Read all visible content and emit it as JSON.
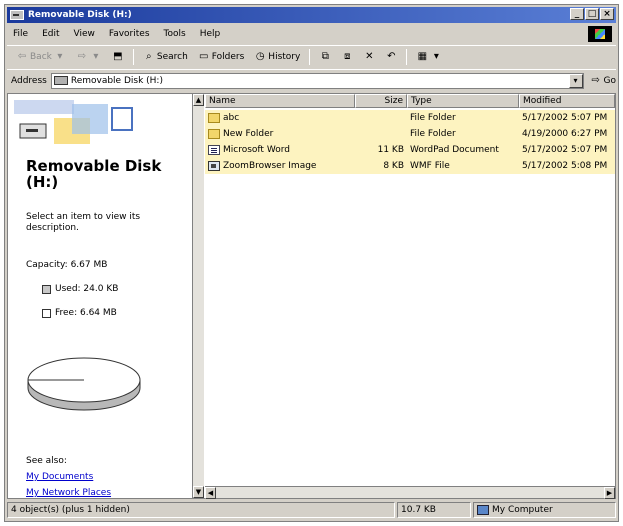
{
  "window": {
    "title": "Removable Disk (H:)",
    "controls": {
      "minimize": "_",
      "maximize": "□",
      "close": "×"
    }
  },
  "menu": [
    "File",
    "Edit",
    "View",
    "Favorites",
    "Tools",
    "Help"
  ],
  "toolbar": {
    "back": "Back",
    "search": "Search",
    "folders": "Folders",
    "history": "History"
  },
  "address": {
    "label": "Address",
    "value": "Removable Disk (H:)",
    "go": "Go"
  },
  "left_pane": {
    "title": "Removable Disk (H:)",
    "description": "Select an item to view its description.",
    "capacity": "Capacity: 6.67 MB",
    "used": "Used: 24.0 KB",
    "free": "Free: 6.64 MB",
    "used_fraction": 0.004,
    "see_also": "See also:",
    "links": [
      "My Documents",
      "My Network Places"
    ]
  },
  "columns": {
    "name": "Name",
    "size": "Size",
    "type": "Type",
    "modified": "Modified"
  },
  "files": [
    {
      "name": "abc",
      "size": "",
      "type": "File Folder",
      "modified": "5/17/2002 5:07 PM",
      "icon": "folder-icon"
    },
    {
      "name": "New Folder",
      "size": "",
      "type": "File Folder",
      "modified": "4/19/2000 6:27 PM",
      "icon": "folder-icon"
    },
    {
      "name": "Microsoft Word",
      "size": "11 KB",
      "type": "WordPad Document",
      "modified": "5/17/2002 5:07 PM",
      "icon": "document-icon"
    },
    {
      "name": "ZoomBrowser Image",
      "size": "8 KB",
      "type": "WMF File",
      "modified": "5/17/2002 5:08 PM",
      "icon": "image-icon"
    }
  ],
  "status": {
    "objects": "4 object(s) (plus 1 hidden)",
    "size": "10.7 KB",
    "zone": "My Computer"
  },
  "colors": {
    "titlebar": "#1b3a9c",
    "selection_highlight": "#fdf3c0",
    "link": "#0000cc"
  }
}
